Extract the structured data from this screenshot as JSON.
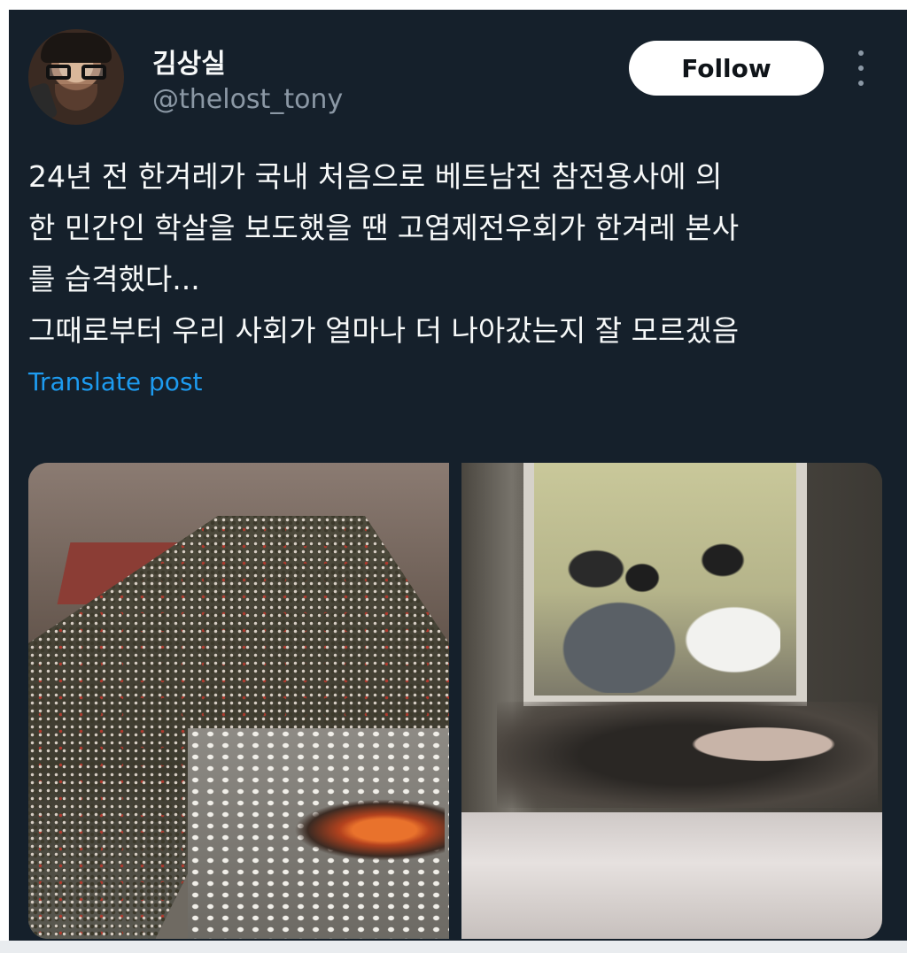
{
  "post": {
    "author": {
      "display_name": "김상실",
      "handle": "@thelost_tony"
    },
    "follow_label": "Follow",
    "more_icon": "more-vertical-icon",
    "text_lines": [
      "24년 전 한겨레가 국내 처음으로 베트남전 참전용사에 의",
      "한 민간인 학살을 보도했을 땐 고엽제전우회가 한겨레 본사",
      "를 습격했다...",
      "그때로부터 우리 사회가 얼마나 더 나아갔는지 잘 모르겠음"
    ],
    "translate_label": "Translate post",
    "media_count": 2
  },
  "colors": {
    "background": "#15202b",
    "text": "#f7f9f9",
    "secondary_text": "#8b98a5",
    "link": "#1d9bf0",
    "follow_button_bg": "#ffffff",
    "follow_button_text": "#0f1419"
  }
}
